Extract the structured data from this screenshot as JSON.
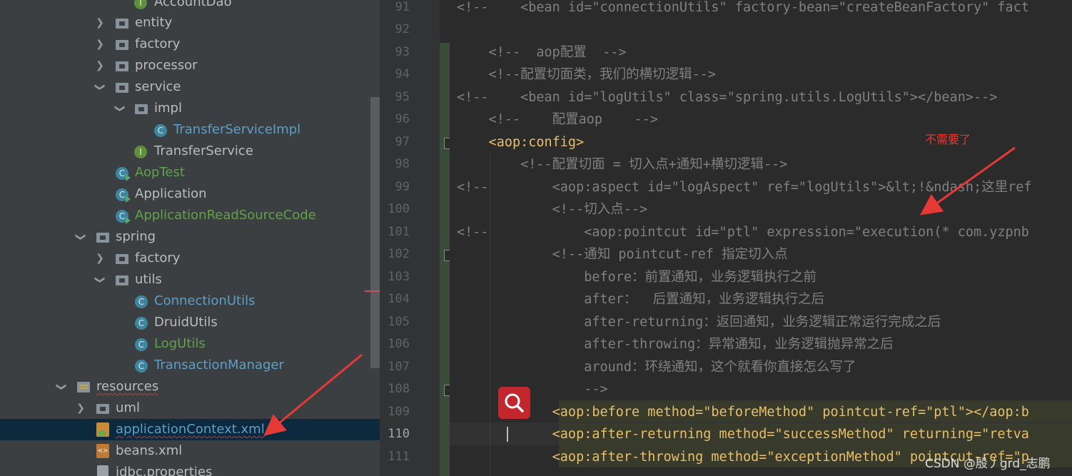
{
  "project_tree": {
    "items": [
      {
        "label": "AccountDao",
        "kind": "interface",
        "color": "#bbbbbb"
      },
      {
        "label": "entity",
        "kind": "folder",
        "expanded": false
      },
      {
        "label": "factory",
        "kind": "folder",
        "expanded": false
      },
      {
        "label": "processor",
        "kind": "folder",
        "expanded": false
      },
      {
        "label": "service",
        "kind": "folder",
        "expanded": true
      },
      {
        "label": "impl",
        "kind": "folder",
        "expanded": true
      },
      {
        "label": "TransferServiceImpl",
        "kind": "class",
        "color": "#5d9fc7"
      },
      {
        "label": "TransferService",
        "kind": "interface",
        "color": "#bbbbbb"
      },
      {
        "label": "AopTest",
        "kind": "runnable-class",
        "color": "#62a14b"
      },
      {
        "label": "Application",
        "kind": "runnable-class",
        "color": "#bbbbbb"
      },
      {
        "label": "ApplicationReadSourceCode",
        "kind": "runnable-class",
        "color": "#62a14b"
      },
      {
        "label": "spring",
        "kind": "folder",
        "expanded": true
      },
      {
        "label": "factory",
        "kind": "folder",
        "expanded": false
      },
      {
        "label": "utils",
        "kind": "folder",
        "expanded": true
      },
      {
        "label": "ConnectionUtils",
        "kind": "class",
        "color": "#5d9fc7"
      },
      {
        "label": "DruidUtils",
        "kind": "class",
        "color": "#bbbbbb"
      },
      {
        "label": "LogUtils",
        "kind": "class",
        "color": "#62a14b"
      },
      {
        "label": "TransactionManager",
        "kind": "class",
        "color": "#5d9fc7"
      },
      {
        "label": "resources",
        "kind": "resources-folder",
        "expanded": true
      },
      {
        "label": "uml",
        "kind": "folder",
        "expanded": false
      },
      {
        "label": "applicationContext.xml",
        "kind": "xml-file",
        "color": "#5d9fc7",
        "selected": true
      },
      {
        "label": "beans.xml",
        "kind": "xml-file",
        "color": "#bbbbbb"
      },
      {
        "label": "jdbc.properties",
        "kind": "properties-file",
        "color": "#bbbbbb"
      }
    ]
  },
  "editor": {
    "current_line": "110",
    "lines": [
      {
        "num": "91",
        "text": "<!--    <bean id=\"connectionUtils\" factory-bean=\"createBeanFactory\" fact"
      },
      {
        "num": "92",
        "text": ""
      },
      {
        "num": "93",
        "text": "    <!--  aop配置  -->"
      },
      {
        "num": "94",
        "text": "    <!--配置切面类，我们的横切逻辑-->"
      },
      {
        "num": "95",
        "text": "<!--    <bean id=\"logUtils\" class=\"spring.utils.LogUtils\"></bean>-->"
      },
      {
        "num": "96",
        "text": "    <!--    配置aop    -->"
      },
      {
        "num": "97",
        "text": "    <aop:config>"
      },
      {
        "num": "98",
        "text": "        <!--配置切面 = 切入点+通知+横切逻辑-->"
      },
      {
        "num": "99",
        "text": "<!--        <aop:aspect id=\"logAspect\" ref=\"logUtils\">&lt;!&ndash;这里ref"
      },
      {
        "num": "100",
        "text": "            <!--切入点-->"
      },
      {
        "num": "101",
        "text": "<!--            <aop:pointcut id=\"ptl\" expression=\"execution(* com.yzpnb"
      },
      {
        "num": "102",
        "text": "            <!--通知 pointcut-ref 指定切入点"
      },
      {
        "num": "103",
        "text": "                before：前置通知，业务逻辑执行之前"
      },
      {
        "num": "104",
        "text": "                after：  后置通知，业务逻辑执行之后"
      },
      {
        "num": "105",
        "text": "                after-returning：返回通知，业务逻辑正常运行完成之后"
      },
      {
        "num": "106",
        "text": "                after-throwing：异常通知，业务逻辑抛异常之后"
      },
      {
        "num": "107",
        "text": "                around：环绕通知，这个就看你直接怎么写了"
      },
      {
        "num": "108",
        "text": "                -->"
      },
      {
        "num": "109",
        "text": "            <aop:before method=\"beforeMethod\" pointcut-ref=\"ptl\"></aop:b"
      },
      {
        "num": "110",
        "text": "            <aop:after-returning method=\"successMethod\" returning=\"retva"
      },
      {
        "num": "111",
        "text": "            <aop:after-throwing method=\"exceptionMethod\" pointcut-ref=\"p"
      }
    ]
  },
  "annotations": {
    "note": "不需要了",
    "watermark": "CSDN @殷丿grd_志鹏"
  },
  "colors": {
    "tree_bg": "#3c3f41",
    "editor_bg": "#2b2b2b",
    "xml_tag": "#e8bf6a",
    "xml_value": "#6a8759",
    "comment": "#808080",
    "annotation_red": "#e53935"
  }
}
